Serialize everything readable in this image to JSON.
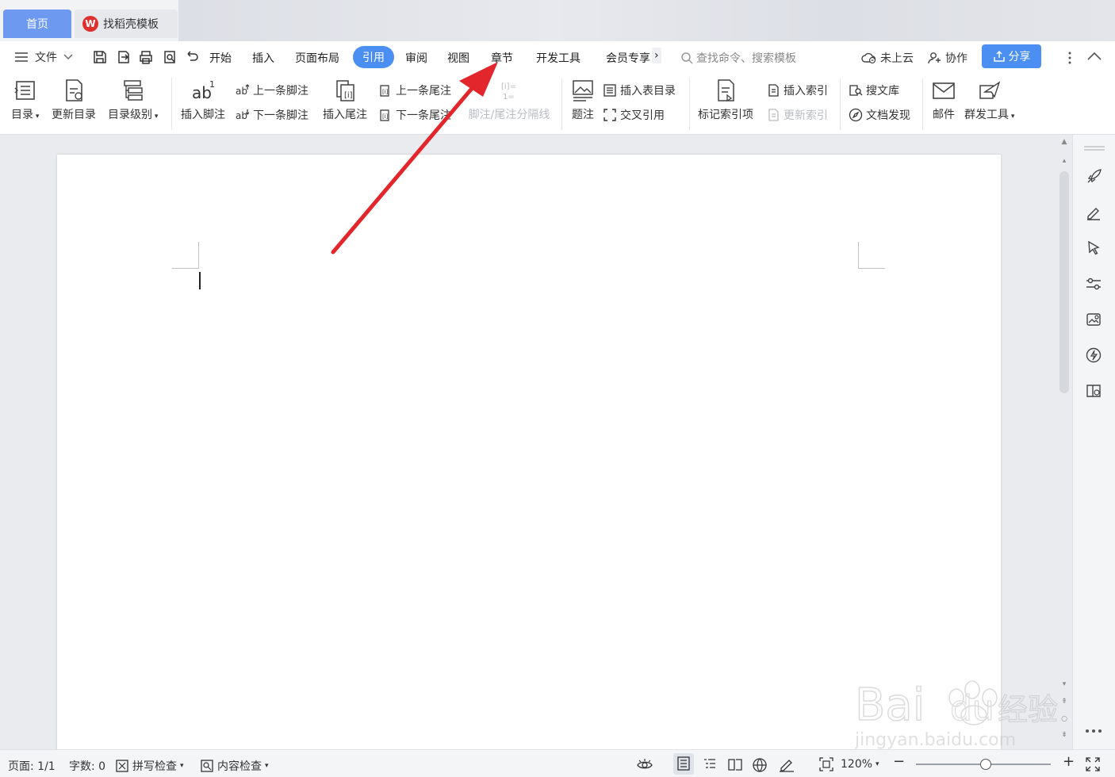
{
  "tabs": {
    "home": "首页",
    "doc": "找稻壳模板",
    "doc_logo": "W"
  },
  "menu": {
    "file": "文件",
    "items": [
      "开始",
      "插入",
      "页面布局",
      "引用",
      "审阅",
      "视图",
      "章节",
      "开发工具",
      "会员专享"
    ],
    "active": "引用",
    "search_placeholder": "查找命令、搜索模板",
    "cloud": "未上云",
    "collab": "协作",
    "share": "分享"
  },
  "ribbon": {
    "toc": "目录",
    "update_toc": "更新目录",
    "toc_level": "目录级别",
    "insert_footnote": "插入脚注",
    "prev_footnote": "上一条脚注",
    "next_footnote": "下一条脚注",
    "insert_endnote": "插入尾注",
    "prev_endnote": "上一条尾注",
    "next_endnote": "下一条尾注",
    "separator": "脚注/尾注分隔线",
    "caption": "题注",
    "insert_table_toc": "插入表目录",
    "cross_ref": "交叉引用",
    "mark_index": "标记索引项",
    "insert_index": "插入索引",
    "update_index": "更新索引",
    "search_lib": "搜文库",
    "doc_discover": "文档发现",
    "mail": "邮件",
    "mass_tool": "群发工具"
  },
  "status": {
    "page": "页面: 1/1",
    "words": "字数: 0",
    "spell": "拼写检查",
    "content_check": "内容检查",
    "zoom": "120%",
    "zoom_level": 0.52
  },
  "watermark": {
    "brand": "Bai",
    "brand2": "du",
    "jingyan": "经验",
    "url": "jingyan.baidu.com"
  },
  "colors": {
    "accent": "#4c8ff2",
    "arrow": "#e3262b"
  }
}
